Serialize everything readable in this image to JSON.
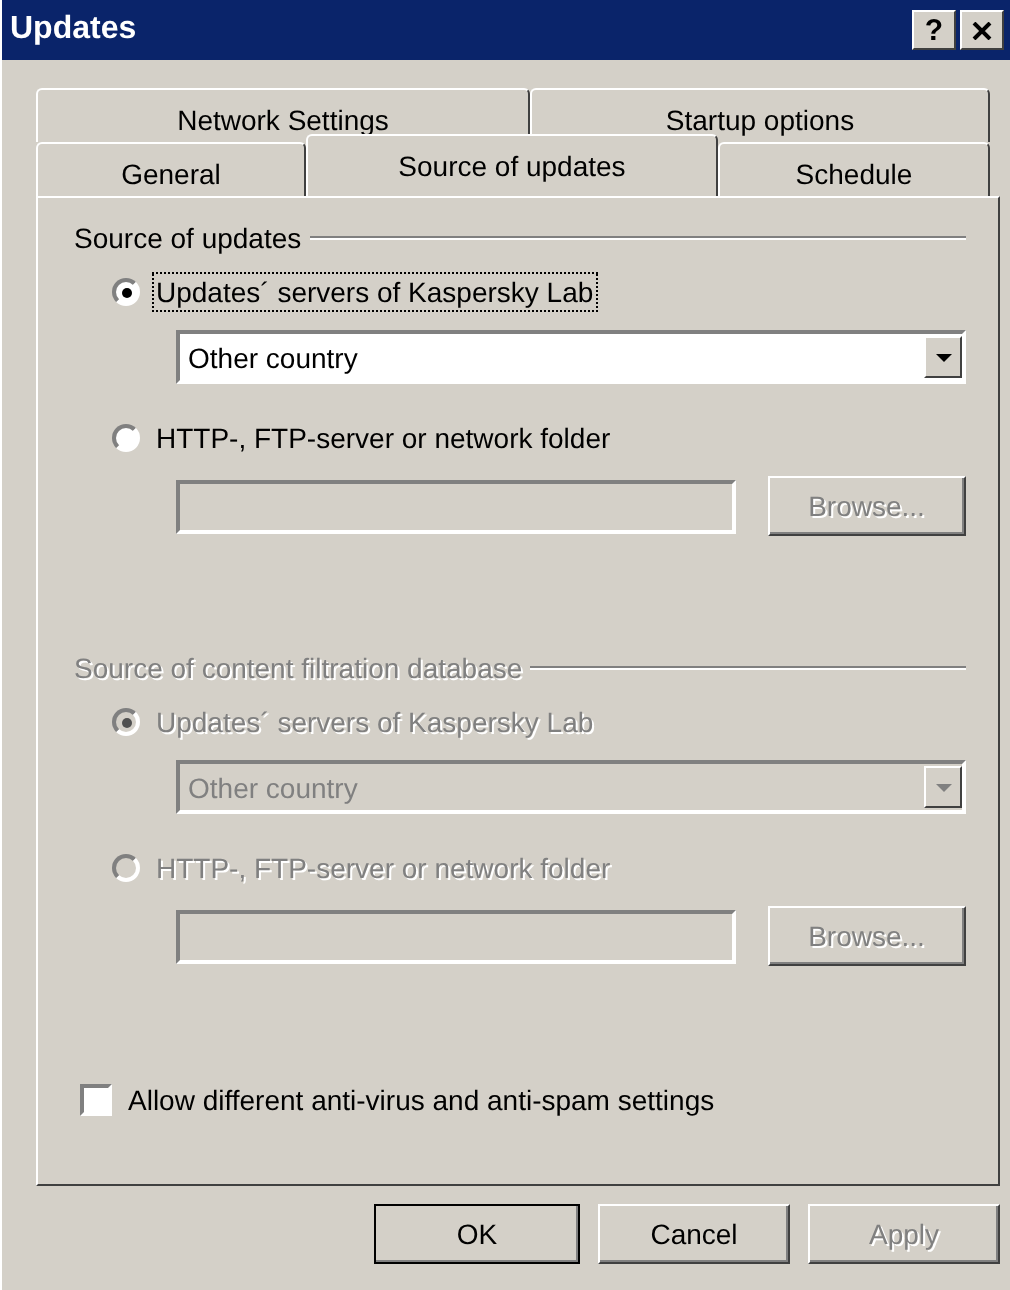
{
  "window": {
    "title": "Updates",
    "help_button": "?"
  },
  "tab_rows": [
    [
      {
        "label": "Network Settings",
        "selected": false
      },
      {
        "label": "Startup options",
        "selected": false
      }
    ],
    [
      {
        "label": "General",
        "selected": false
      },
      {
        "label": "Source of updates",
        "selected": true
      },
      {
        "label": "Schedule",
        "selected": false
      }
    ]
  ],
  "groups": [
    {
      "legend": "Source of updates",
      "disabled": false,
      "options": [
        {
          "kind": "server",
          "label": "Updates´ servers of Kaspersky Lab",
          "selected": true,
          "focused": true,
          "dropdown": "Other country"
        },
        {
          "kind": "folder",
          "label": "HTTP-, FTP-server or network folder",
          "selected": false,
          "focused": false,
          "button": "Browse..."
        }
      ]
    },
    {
      "legend": "Source of content filtration database",
      "disabled": true,
      "options": [
        {
          "kind": "server",
          "label": "Updates´ servers of Kaspersky Lab",
          "selected": true,
          "focused": false,
          "dropdown": "Other country"
        },
        {
          "kind": "folder",
          "label": "HTTP-, FTP-server or network folder",
          "selected": false,
          "focused": false,
          "button": "Browse..."
        }
      ]
    }
  ],
  "checkbox": {
    "label": "Allow different anti-virus and anti-spam settings",
    "checked": false
  },
  "buttons": [
    {
      "label": "OK",
      "default": true,
      "disabled": false
    },
    {
      "label": "Cancel",
      "default": false,
      "disabled": false
    },
    {
      "label": "Apply",
      "default": false,
      "disabled": true
    }
  ]
}
